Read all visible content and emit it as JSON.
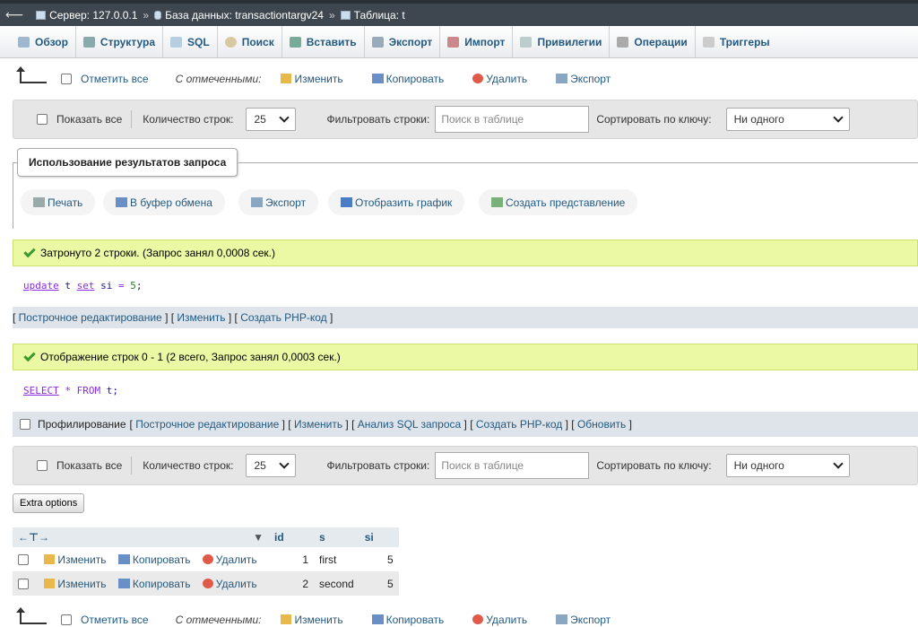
{
  "breadcrumb": {
    "server": "Сервер: 127.0.0.1",
    "database": "База данных: transactiontargv24",
    "table": "Таблица: t",
    "separator": "»"
  },
  "tabs": [
    {
      "label": "Обзор",
      "icon": "browse-icon"
    },
    {
      "label": "Структура",
      "icon": "structure-icon"
    },
    {
      "label": "SQL",
      "icon": "sql-icon"
    },
    {
      "label": "Поиск",
      "icon": "search-icon"
    },
    {
      "label": "Вставить",
      "icon": "insert-icon"
    },
    {
      "label": "Экспорт",
      "icon": "export-icon"
    },
    {
      "label": "Импорт",
      "icon": "import-icon"
    },
    {
      "label": "Привилегии",
      "icon": "privileges-icon"
    },
    {
      "label": "Операции",
      "icon": "wrench-icon"
    },
    {
      "label": "Триггеры",
      "icon": "triggers-icon"
    }
  ],
  "bulk": {
    "check_all": "Отметить все",
    "with_selected": "С отмеченными:",
    "edit": "Изменить",
    "copy": "Копировать",
    "delete": "Удалить",
    "export": "Экспорт"
  },
  "nav": {
    "show_all": "Показать все",
    "rows_label": "Количество строк:",
    "rows_value": "25",
    "filter_label": "Фильтровать строки:",
    "filter_placeholder": "Поиск в таблице",
    "sort_label": "Сортировать по ключу:",
    "sort_value": "Ни одного"
  },
  "query_ops": {
    "legend": "Использование результатов запроса",
    "print": "Печать",
    "clipboard": "В буфер обмена",
    "export": "Экспорт",
    "chart": "Отобразить график",
    "view": "Создать представление"
  },
  "update_result": {
    "message": "Затронуто 2 строки. (Запрос занял 0,0008 сек.)",
    "sql": {
      "kw1": "update",
      "tbl": "t",
      "kw2": "set",
      "rest": "si",
      "eq": "=",
      "num": "5",
      "end": ";"
    },
    "links": {
      "inline_edit": "Построчное редактирование",
      "edit": "Изменить",
      "php": "Создать PHP-код"
    }
  },
  "select_result": {
    "message": "Отображение строк 0 - 1 (2 всего, Запрос занял 0,0003 сек.)",
    "sql": {
      "kw1": "SELECT",
      "star": "*",
      "kw2": "FROM",
      "tbl": "t;"
    },
    "profiling": "Профилирование",
    "links": {
      "inline_edit": "Построчное редактирование",
      "edit": "Изменить",
      "analyze": "Анализ SQL запроса",
      "php": "Создать PHP-код",
      "refresh": "Обновить"
    }
  },
  "extra_options": "Extra options",
  "table": {
    "columns": [
      "id",
      "s",
      "si"
    ],
    "rows": [
      {
        "edit": "Изменить",
        "copy": "Копировать",
        "delete": "Удалить",
        "id": "1",
        "s": "first",
        "si": "5"
      },
      {
        "edit": "Изменить",
        "copy": "Копировать",
        "delete": "Удалить",
        "id": "2",
        "s": "second",
        "si": "5"
      }
    ]
  }
}
